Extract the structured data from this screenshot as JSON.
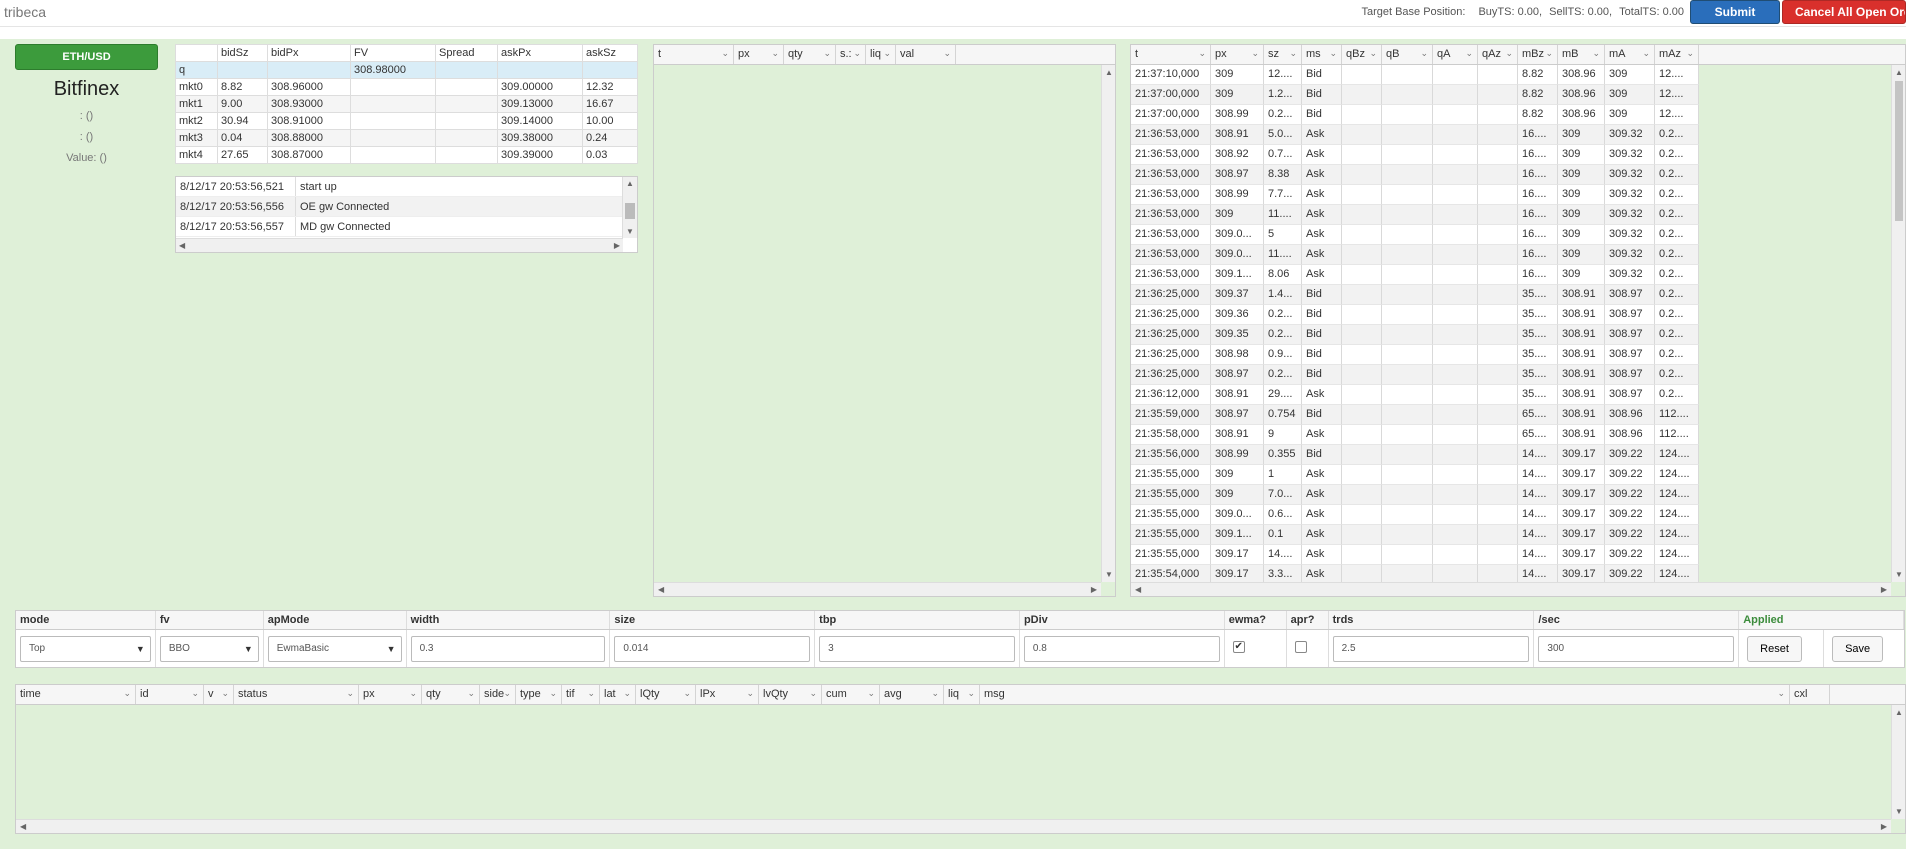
{
  "app": {
    "title": "tribeca",
    "target_base_position": "Target Base Position:",
    "buy_ts": "BuyTS: 0.00,",
    "sell_ts": "SellTS: 0.00,",
    "total_ts": "TotalTS: 0.00",
    "submit_order": "Submit order",
    "cancel_all": "Cancel All Open Orders"
  },
  "exchange": {
    "pair": "ETH/USD",
    "name": "Bitfinex",
    "line1": ": ()",
    "line2": ": ()",
    "value": "Value: ()"
  },
  "market": {
    "headers": [
      "",
      "bidSz",
      "bidPx",
      "FV",
      "Spread",
      "askPx",
      "askSz"
    ],
    "q_row": {
      "label": "q",
      "fv": "308.98000"
    },
    "rows": [
      [
        "mkt0",
        "8.82",
        "308.96000",
        "",
        "",
        "309.00000",
        "12.32"
      ],
      [
        "mkt1",
        "9.00",
        "308.93000",
        "",
        "",
        "309.13000",
        "16.67"
      ],
      [
        "mkt2",
        "30.94",
        "308.91000",
        "",
        "",
        "309.14000",
        "10.00"
      ],
      [
        "mkt3",
        "0.04",
        "308.88000",
        "",
        "",
        "309.38000",
        "0.24"
      ],
      [
        "mkt4",
        "27.65",
        "308.87000",
        "",
        "",
        "309.39000",
        "0.03"
      ]
    ]
  },
  "messages": [
    {
      "time": "8/12/17 20:53:56,521",
      "msg": "start up"
    },
    {
      "time": "8/12/17 20:53:56,556",
      "msg": "OE gw Connected"
    },
    {
      "time": "8/12/17 20:53:56,557",
      "msg": "MD gw Connected"
    }
  ],
  "trades_own": {
    "headers": [
      "t",
      "px",
      "qty",
      "s.:",
      "liq",
      "val"
    ]
  },
  "trades_market": {
    "headers": [
      "t",
      "px",
      "sz",
      "ms",
      "qBz",
      "qB",
      "qA",
      "qAz",
      "mBz",
      "mB",
      "mA",
      "mAz"
    ],
    "rows": [
      [
        "21:37:10,000",
        "309",
        "12....",
        "Bid",
        "",
        "",
        "",
        "",
        "8.82",
        "308.96",
        "309",
        "12...."
      ],
      [
        "21:37:00,000",
        "309",
        "1.2...",
        "Bid",
        "",
        "",
        "",
        "",
        "8.82",
        "308.96",
        "309",
        "12...."
      ],
      [
        "21:37:00,000",
        "308.99",
        "0.2...",
        "Bid",
        "",
        "",
        "",
        "",
        "8.82",
        "308.96",
        "309",
        "12...."
      ],
      [
        "21:36:53,000",
        "308.91",
        "5.0...",
        "Ask",
        "",
        "",
        "",
        "",
        "16....",
        "309",
        "309.32",
        "0.2..."
      ],
      [
        "21:36:53,000",
        "308.92",
        "0.7...",
        "Ask",
        "",
        "",
        "",
        "",
        "16....",
        "309",
        "309.32",
        "0.2..."
      ],
      [
        "21:36:53,000",
        "308.97",
        "8.38",
        "Ask",
        "",
        "",
        "",
        "",
        "16....",
        "309",
        "309.32",
        "0.2..."
      ],
      [
        "21:36:53,000",
        "308.99",
        "7.7...",
        "Ask",
        "",
        "",
        "",
        "",
        "16....",
        "309",
        "309.32",
        "0.2..."
      ],
      [
        "21:36:53,000",
        "309",
        "11....",
        "Ask",
        "",
        "",
        "",
        "",
        "16....",
        "309",
        "309.32",
        "0.2..."
      ],
      [
        "21:36:53,000",
        "309.0...",
        "5",
        "Ask",
        "",
        "",
        "",
        "",
        "16....",
        "309",
        "309.32",
        "0.2..."
      ],
      [
        "21:36:53,000",
        "309.0...",
        "11....",
        "Ask",
        "",
        "",
        "",
        "",
        "16....",
        "309",
        "309.32",
        "0.2..."
      ],
      [
        "21:36:53,000",
        "309.1...",
        "8.06",
        "Ask",
        "",
        "",
        "",
        "",
        "16....",
        "309",
        "309.32",
        "0.2..."
      ],
      [
        "21:36:25,000",
        "309.37",
        "1.4...",
        "Bid",
        "",
        "",
        "",
        "",
        "35....",
        "308.91",
        "308.97",
        "0.2..."
      ],
      [
        "21:36:25,000",
        "309.36",
        "0.2...",
        "Bid",
        "",
        "",
        "",
        "",
        "35....",
        "308.91",
        "308.97",
        "0.2..."
      ],
      [
        "21:36:25,000",
        "309.35",
        "0.2...",
        "Bid",
        "",
        "",
        "",
        "",
        "35....",
        "308.91",
        "308.97",
        "0.2..."
      ],
      [
        "21:36:25,000",
        "308.98",
        "0.9...",
        "Bid",
        "",
        "",
        "",
        "",
        "35....",
        "308.91",
        "308.97",
        "0.2..."
      ],
      [
        "21:36:25,000",
        "308.97",
        "0.2...",
        "Bid",
        "",
        "",
        "",
        "",
        "35....",
        "308.91",
        "308.97",
        "0.2..."
      ],
      [
        "21:36:12,000",
        "308.91",
        "29....",
        "Ask",
        "",
        "",
        "",
        "",
        "35....",
        "308.91",
        "308.97",
        "0.2..."
      ],
      [
        "21:35:59,000",
        "308.97",
        "0.754",
        "Bid",
        "",
        "",
        "",
        "",
        "65....",
        "308.91",
        "308.96",
        "112...."
      ],
      [
        "21:35:58,000",
        "308.91",
        "9",
        "Ask",
        "",
        "",
        "",
        "",
        "65....",
        "308.91",
        "308.96",
        "112...."
      ],
      [
        "21:35:56,000",
        "308.99",
        "0.355",
        "Bid",
        "",
        "",
        "",
        "",
        "14....",
        "309.17",
        "309.22",
        "124...."
      ],
      [
        "21:35:55,000",
        "309",
        "1",
        "Ask",
        "",
        "",
        "",
        "",
        "14....",
        "309.17",
        "309.22",
        "124...."
      ],
      [
        "21:35:55,000",
        "309",
        "7.0...",
        "Ask",
        "",
        "",
        "",
        "",
        "14....",
        "309.17",
        "309.22",
        "124...."
      ],
      [
        "21:35:55,000",
        "309.0...",
        "0.6...",
        "Ask",
        "",
        "",
        "",
        "",
        "14....",
        "309.17",
        "309.22",
        "124...."
      ],
      [
        "21:35:55,000",
        "309.1...",
        "0.1",
        "Ask",
        "",
        "",
        "",
        "",
        "14....",
        "309.17",
        "309.22",
        "124...."
      ],
      [
        "21:35:55,000",
        "309.17",
        "14....",
        "Ask",
        "",
        "",
        "",
        "",
        "14....",
        "309.17",
        "309.22",
        "124...."
      ],
      [
        "21:35:54,000",
        "309.17",
        "3.3...",
        "Ask",
        "",
        "",
        "",
        "",
        "14....",
        "309.17",
        "309.22",
        "124...."
      ]
    ]
  },
  "params": {
    "labels": [
      "mode",
      "fv",
      "apMode",
      "width",
      "size",
      "tbp",
      "pDiv",
      "ewma?",
      "apr?",
      "trds",
      "/sec",
      "Applied"
    ],
    "mode": "Top",
    "fv": "BBO",
    "apMode": "EwmaBasic",
    "width": "0.3",
    "size": "0.014",
    "tbp": "3",
    "pDiv": "0.8",
    "ewma_checked": "✔",
    "trds": "2.5",
    "per_sec": "300",
    "reset": "Reset",
    "save": "Save"
  },
  "orders": {
    "headers": [
      "time",
      "id",
      "v",
      "status",
      "px",
      "qty",
      "side",
      "type",
      "tif",
      "lat",
      "lQty",
      "lPx",
      "lvQty",
      "cum",
      "avg",
      "liq",
      "msg",
      "cxl"
    ]
  },
  "colors": {
    "panel_green": "#dff0d8",
    "submit_blue": "#2a6ebb",
    "cancel_red": "#d9302c",
    "pair_green": "#3c9b3c"
  }
}
